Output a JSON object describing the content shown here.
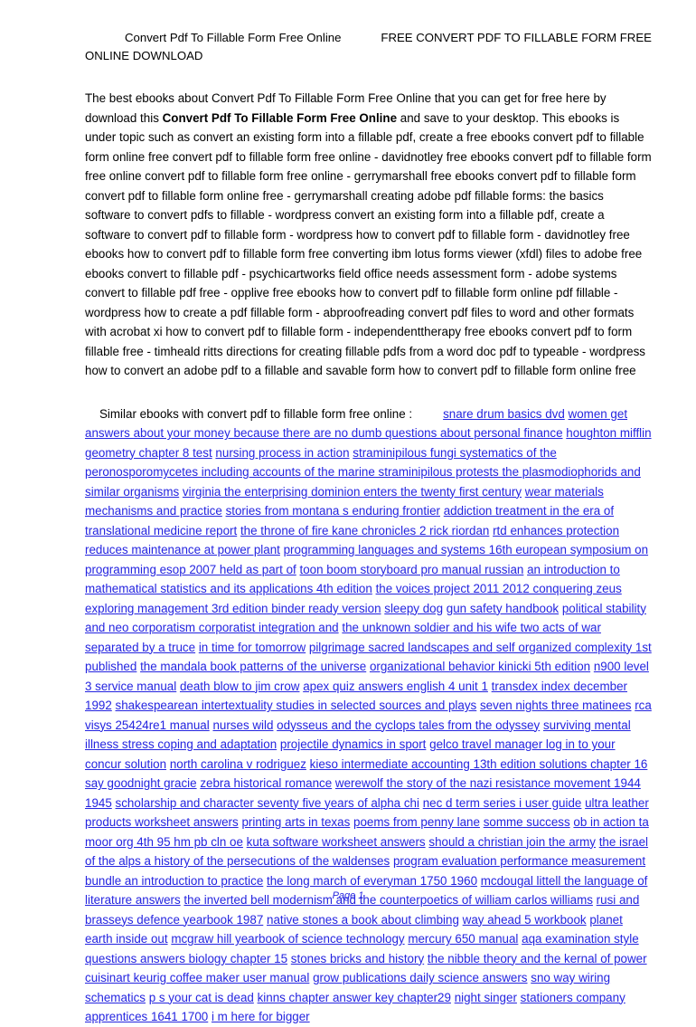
{
  "document": {
    "header": {
      "title_line": "Convert Pdf To Fillable Form Free Online",
      "title_right": "FREE CONVERT PDF TO FILLABLE FORM",
      "subtitle": "FREE ONLINE DOWNLOAD"
    },
    "description": {
      "part1": "The best ebooks about Convert Pdf To Fillable Form Free Online that you can get for free here by download this ",
      "bold": "Convert Pdf To Fillable Form Free Online",
      "part2": " and save to your desktop. This ebooks is under topic such as convert an existing form into a fillable pdf, create a  free ebooks convert pdf to fillable form online free convert pdf to fillable form free online - davidnotley free ebooks convert pdf to fillable form free online convert pdf to fillable form free online - gerrymarshall free ebooks convert pdf to fillable form convert pdf to fillable form online free - gerrymarshall creating adobe pdf fillable forms: the basics software to convert pdfs to fillable - wordpress convert an existing form into a fillable pdf, create a  software to convert pdf to fillable form - wordpress how to convert pdf to fillable form - davidnotley free ebooks how to convert pdf to fillable form free converting ibm lotus forms viewer (xfdl) files to adobe  free ebooks convert to fillable pdf - psychicartworks field office needs assessment form - adobe systems convert to fillable pdf free - opplive free ebooks how to convert pdf to fillable form online pdf fillable - wordpress how to create a pdf fillable form - abproofreading convert pdf files to word and other formats with acrobat xi how to convert pdf to fillable form - independenttherapy free ebooks convert pdf to form fillable free - timheald ritts directions for creating fillable pdfs from a word doc pdf to typeable - wordpress how to convert an adobe pdf to a fillable and savable form how to convert pdf to fillable form online free"
    },
    "similar_section": {
      "lead_text": "Similar ebooks with convert pdf to fillable form free online :",
      "links": [
        "snare drum basics dvd",
        "women get answers about your money because there are no dumb questions about personal finance",
        "houghton mifflin geometry chapter 8 test",
        "nursing process in action",
        "straminipilous fungi systematics of the peronosporomycetes including accounts of the marine straminipilous protests the plasmodiophorids and similar organisms",
        "virginia the enterprising dominion enters the twenty first century",
        "wear materials mechanisms and practice",
        "stories from montana s enduring frontier",
        "addiction treatment in the era of translational medicine report",
        "the throne of fire kane chronicles 2 rick riordan",
        "rtd enhances protection reduces maintenance at power plant",
        "programming languages and systems 16th european symposium on programming esop 2007 held as part of",
        "toon boom storyboard pro manual russian",
        "an introduction to mathematical statistics and its applications 4th edition",
        "the voices project 2011 2012 conquering zeus",
        "exploring management 3rd edition binder ready version",
        "sleepy dog",
        "gun safety handbook",
        "political stability and neo corporatism corporatist integration and",
        "the unknown soldier and his wife two acts of war separated by a truce",
        "in time for tomorrow",
        "pilgrimage sacred landscapes and self organized complexity 1st published",
        "the mandala book patterns of the universe",
        "organizational behavior kinicki 5th edition",
        "n900 level 3 service manual",
        "death blow to jim crow",
        "apex quiz answers english 4 unit 1",
        "transdex index december 1992",
        "shakespearean intertextuality studies in selected sources and plays",
        "seven nights three matinees",
        "rca visys 25424re1 manual",
        "nurses wild",
        "odysseus and the cyclops tales from the odyssey",
        "surviving mental illness stress coping and adaptation",
        "projectile dynamics in sport",
        "gelco travel manager log in to your concur solution",
        "north carolina v rodriguez",
        "kieso intermediate accounting 13th edition solutions chapter 16",
        "say goodnight gracie",
        "zebra historical romance",
        "werewolf the story of the nazi resistance movement 1944 1945",
        "scholarship and character seventy five years of alpha chi",
        "nec d term series i user guide",
        "ultra leather products worksheet answers",
        "printing arts in texas",
        "poems from penny lane",
        "somme success",
        "ob in action ta moor org 4th 95 hm pb cln oe",
        "kuta software worksheet answers",
        "should a christian join the army",
        "the israel of the alps a history of the persecutions of the waldenses",
        "program evaluation performance measurement bundle an introduction to practice",
        "the long march of everyman 1750 1960",
        "mcdougal littell the language of literature answers",
        "the inverted bell modernism and the counterpoetics of william carlos williams",
        "rusi and brasseys defence yearbook 1987",
        "native stones a book about climbing",
        "way ahead 5 workbook",
        "planet earth inside out",
        "mcgraw hill yearbook of science technology",
        "mercury 650 manual",
        "aqa examination style questions answers biology chapter 15",
        "stones bricks and history",
        "the nibble theory and the kernal of power",
        "cuisinart keurig coffee maker user manual",
        "grow publications daily science answers",
        "sno way wiring schematics",
        "p s your cat is dead",
        "kinns chapter answer key chapter29",
        "night singer",
        "stationers company apprentices 1641 1700",
        "i m here for bigger"
      ]
    },
    "footer": {
      "page_label": "Page 1"
    },
    "colors": {
      "link": "#2424E0",
      "text": "#000000",
      "background": "#FFFFFF"
    }
  }
}
